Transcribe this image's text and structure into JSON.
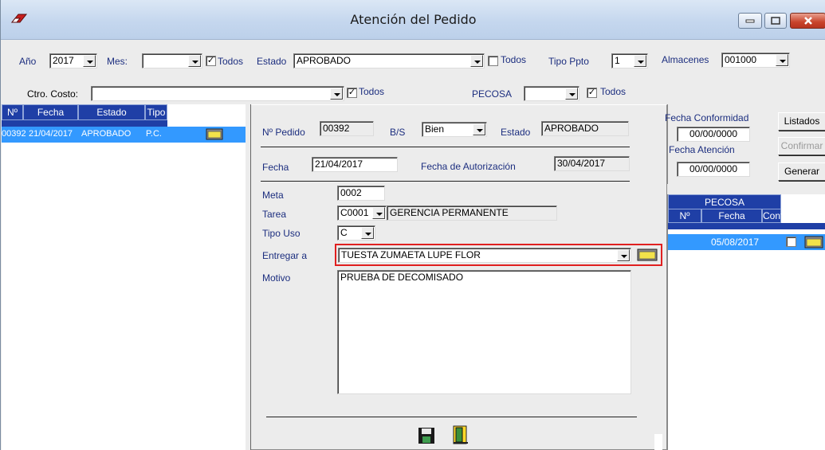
{
  "window": {
    "title": "Atención del Pedido"
  },
  "filters": {
    "anio_label": "Año",
    "anio_value": "2017",
    "mes_label": "Mes:",
    "mes_value": "",
    "todos1": "Todos",
    "estado_label": "Estado",
    "estado_value": "APROBADO",
    "todos2": "Todos",
    "tipo_ppto_label": "Tipo Ppto",
    "tipo_ppto_value": "1",
    "almacenes_label": "Almacenes",
    "almacenes_value": "001000",
    "ctro_costo_label": "Ctro. Costo:",
    "ctro_costo_value": "",
    "todos3": "Todos",
    "pecosa_label": "PECOSA",
    "pecosa_value": "",
    "todos4": "Todos"
  },
  "orders": {
    "headers": [
      "Nº",
      "Fecha",
      "Estado",
      "Tipo"
    ],
    "rows": [
      {
        "num": "00392",
        "fecha": "21/04/2017",
        "estado": "APROBADO",
        "tipo": "P.C."
      }
    ]
  },
  "detail": {
    "pedido_label": "Nº Pedido",
    "pedido_value": "00392",
    "bs_label": "B/S",
    "bs_value": "Bien",
    "estado_label": "Estado",
    "estado_value": "APROBADO",
    "fecha_label": "Fecha",
    "fecha_value": "21/04/2017",
    "fecha_aut_label": "Fecha de Autorización",
    "fecha_aut_value": "30/04/2017",
    "meta_label": "Meta",
    "meta_value": "0002",
    "tarea_label": "Tarea",
    "tarea_code": "C0001",
    "tarea_desc": "GERENCIA PERMANENTE",
    "tipo_uso_label": "Tipo Uso",
    "tipo_uso_value": "C",
    "entregar_label": "Entregar a",
    "entregar_value": "TUESTA ZUMAETA LUPE FLOR",
    "motivo_label": "Motivo",
    "motivo_value": "PRUEBA DE DECOMISADO"
  },
  "dates": {
    "conformidad_label": "Fecha Conformidad",
    "conformidad_value": "00/00/0000",
    "atencion_label": "Fecha Atención",
    "atencion_value": "00/00/0000"
  },
  "buttons": {
    "listados": "Listados",
    "confirmar": "Confirmar",
    "generar": "Generar"
  },
  "pecosa_grid": {
    "title": "PECOSA",
    "headers": [
      "Nº",
      "Fecha",
      "Conf."
    ],
    "rows": [
      {
        "num": "",
        "fecha": "05/08/2017"
      }
    ]
  },
  "colors": {
    "header_blue": "#1f3fa6",
    "selection": "#3399ff",
    "label_blue": "#1c2e7f",
    "highlight": "#e02020"
  }
}
